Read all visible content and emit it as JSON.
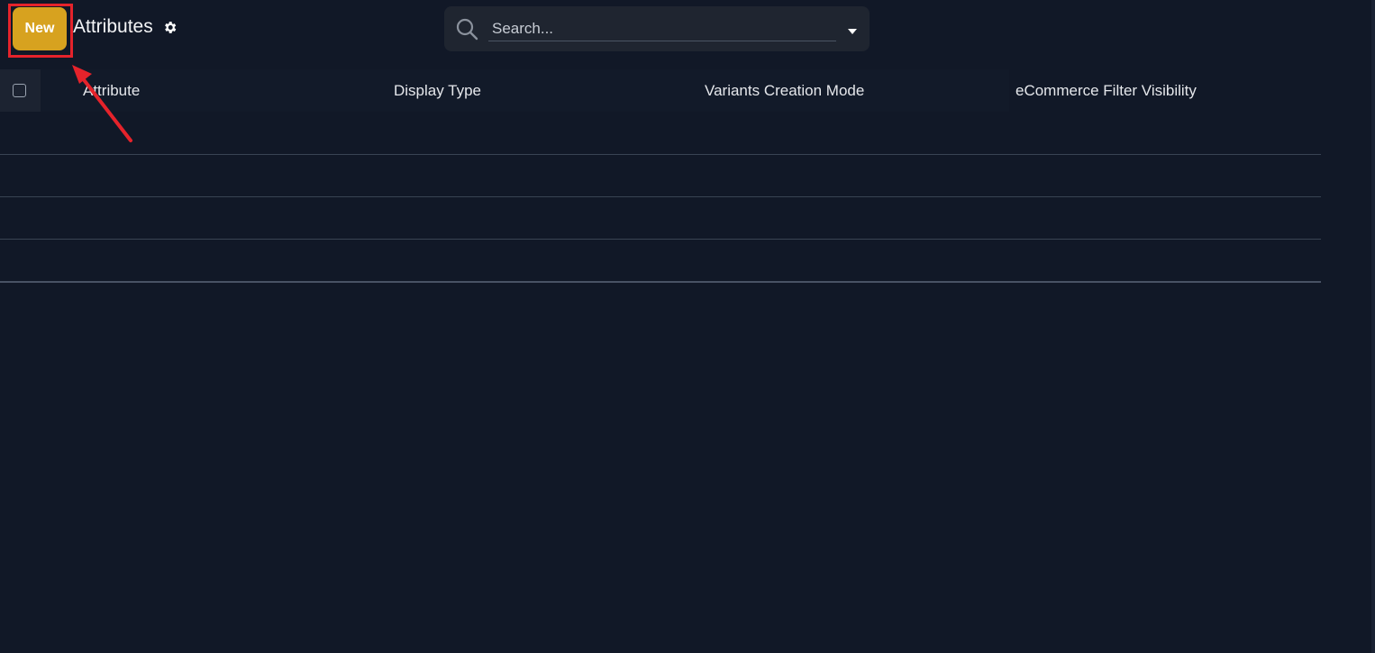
{
  "toolbar": {
    "new_label": "New",
    "title": "Attributes"
  },
  "search": {
    "placeholder": "Search..."
  },
  "table": {
    "columns": [
      "Attribute",
      "Display Type",
      "Variants Creation Mode",
      "eCommerce Filter Visibility"
    ],
    "rows": [
      [],
      [],
      [],
      []
    ]
  },
  "annotation": {
    "highlight_color": "#e5232b"
  },
  "colors": {
    "background": "#111827",
    "accent": "#d7a21f"
  },
  "icons": {
    "settings": "gear-icon",
    "search": "search-icon",
    "dropdown": "caret-down-icon"
  }
}
